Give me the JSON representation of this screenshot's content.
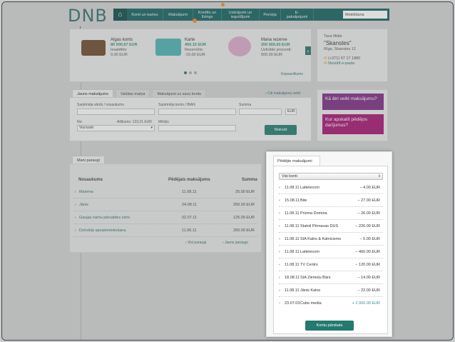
{
  "header": {
    "logo": "DNB",
    "nav": [
      {
        "label": "Konti un kartes"
      },
      {
        "label": "Maksājumi"
      },
      {
        "label": "Kredīts un līzings"
      },
      {
        "label": "Uzkrājumi un ieguldījumi"
      },
      {
        "label": "Pensija"
      },
      {
        "label": "E-pakalpojumi"
      }
    ],
    "search_value": "Meklēšana"
  },
  "accounts": [
    {
      "title": "Algas konts",
      "value": "80 000.67 EUR",
      "sub_label": "Iesaldēts:",
      "sub_value": "0.00 EUR"
    },
    {
      "title": "Karte",
      "value": "450.15 EUR",
      "sub_label": "Rezervēts:",
      "sub_value": "-15.00 EUR"
    },
    {
      "title": "Mana rezerve",
      "value": "200 000.00 EUR",
      "sub_label": "Uzkrātie procenti:",
      "sub_value": "500.00 EUR"
    }
  ],
  "accounts_link": "Kopsavilkums",
  "branch": {
    "label": "Tava filiāle",
    "name": "\"Skanstes\"",
    "address": "Rīga, Skanstes 12",
    "phone": "(+371) 67 17 1880",
    "link": "Nosūtīt e-pastu"
  },
  "payment_form": {
    "tabs": [
      "Jauns maksājums",
      "Valūtas maiņa",
      "Maksājumi uz savu kontu"
    ],
    "own_payments_link": "Citi maksājumu veidi",
    "recipient_label": "Saņēmēja vārds / nosaukums",
    "account_label": "Saņēmēja konts / IBAN",
    "amount_label": "Summa",
    "currency": "EUR",
    "from_label": "No:",
    "available": "Atlikums: 123.21 EUR",
    "from_value": "Visi konti",
    "purpose_label": "Mērķis",
    "pay_button": "Maksāt"
  },
  "promos": [
    {
      "text": "Kā ātri veikt maksājumu?",
      "color": "#7b2d83"
    },
    {
      "text": "Kur apskatīt pēdējos darījumus?",
      "color": "#a3156f"
    }
  ],
  "templates": {
    "tab": "Mani paraugi",
    "headers": [
      "Nosaukums",
      "Pēdējais maksājums",
      "Summa"
    ],
    "rows": [
      {
        "name": "Mamma",
        "date": "11.08.11",
        "amount": "25.00 EUR"
      },
      {
        "name": "Jānis",
        "date": "24.08.11",
        "amount": "250.00 EUR"
      },
      {
        "name": "Gaujas namu pārvaldes cehs",
        "date": "02.07.11",
        "amount": "125.00 EUR"
      },
      {
        "name": "Dzīvokļa apsaimniekošana",
        "date": "11.06.11",
        "amount": "250.00 EUR"
      }
    ],
    "link_all": "Visi paraugi",
    "link_new": "Jauns paraugs"
  },
  "recent": {
    "tab": "Pēdējie maksājumi",
    "filter": "Visi konti",
    "rows": [
      {
        "date": "11.08.11",
        "name": "Lattelecom",
        "amount": "− 4.00 EUR"
      },
      {
        "date": "15.08.11",
        "name": "Bite",
        "amount": "− 27.00 EUR"
      },
      {
        "date": "11.08.11",
        "name": "Prizma Domina",
        "amount": "− 26.00 EUR"
      },
      {
        "date": "11.08.11",
        "name": "Statoil Pērnavas DUS",
        "amount": "− 226.00 EUR"
      },
      {
        "date": "11.08.11",
        "name": "SIA Kalns & Kalniciems",
        "amount": "− 5.00 EUR"
      },
      {
        "date": "11.08.11",
        "name": "Lattelecom",
        "amount": "− 460.00 EUR"
      },
      {
        "date": "11.08.11",
        "name": "TV Centrs",
        "amount": "− 120.00 EUR"
      },
      {
        "date": "18.08.11",
        "name": "SIA Ziemeļu Bārs",
        "amount": "− 14.00 EUR"
      },
      {
        "date": "11.08.11",
        "name": "Jānis Kalns",
        "amount": "− 22.00 EUR"
      },
      {
        "date": "23.07.03",
        "name": "Cube media",
        "amount": "+ 2 000.00 EUR"
      }
    ],
    "button": "Kontu pārskats"
  }
}
